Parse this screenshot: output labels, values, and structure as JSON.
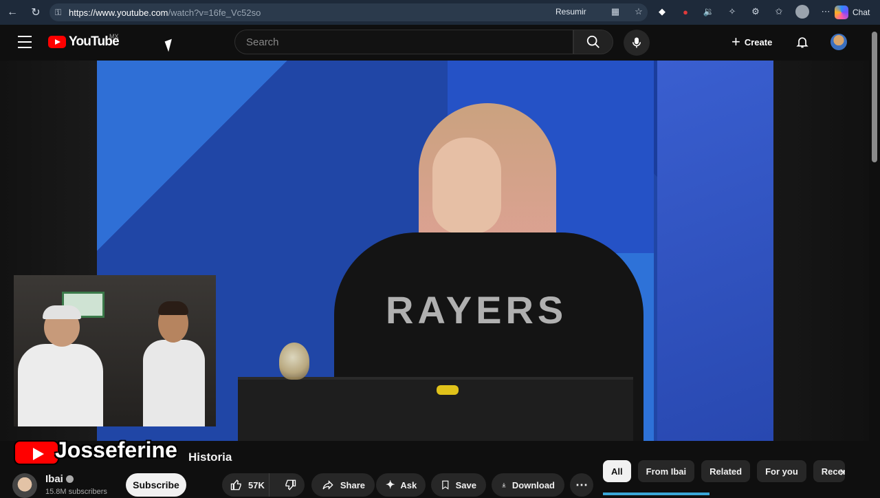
{
  "browser": {
    "url_host": "https://www.youtube.com",
    "url_path": "/watch?v=16fe_Vc52so",
    "summarize_label": "Resumir",
    "chat_label": "Chat"
  },
  "header": {
    "logo_text": "YouTube",
    "country_code": "MX",
    "search_placeholder": "Search",
    "create_label": "Create"
  },
  "video": {
    "title_visible": "Historia",
    "jacket_text": "RAYERS"
  },
  "watermark": {
    "channel": "Josseferine"
  },
  "channel": {
    "name": "Ibai",
    "subscribers": "15.8M subscribers",
    "subscribe_label": "Subscribe"
  },
  "actions": {
    "likes": "57K",
    "share": "Share",
    "ask": "Ask",
    "save": "Save",
    "download": "Download"
  },
  "chips": [
    "All",
    "From Ibai",
    "Related",
    "For you",
    "Recen"
  ],
  "colors": {
    "brand_red": "#ff0000",
    "background": "#0f0f0f",
    "pill": "#272727"
  }
}
